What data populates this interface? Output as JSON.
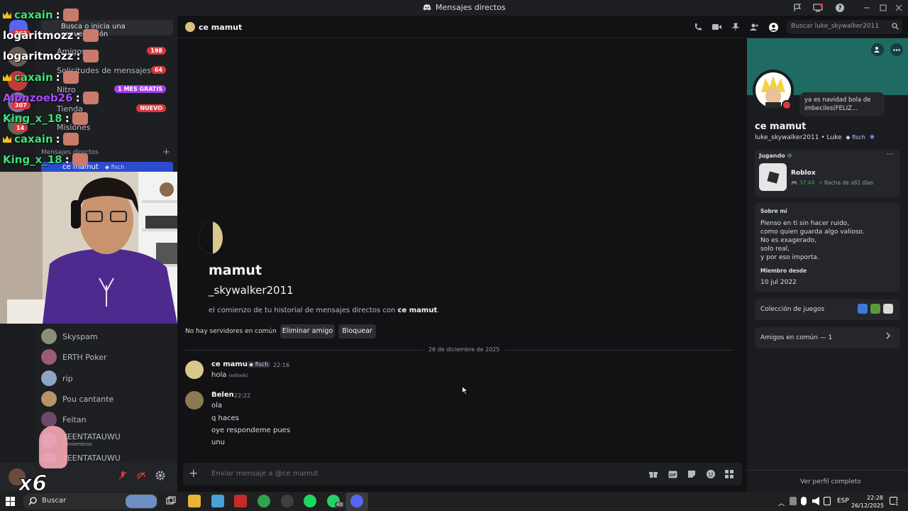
{
  "window": {
    "title": "Mensajes directos"
  },
  "sidebar": {
    "search_placeholder": "Busca o inicia una conversación",
    "nav": [
      {
        "label": "Amigos",
        "badge": "198"
      },
      {
        "label": "Solicitudes de mensajes",
        "badge": "64"
      },
      {
        "label": "Nitro",
        "badge": "1 MES GRATIS"
      },
      {
        "label": "Tienda",
        "badge": "NUEVO"
      },
      {
        "label": "Misiones",
        "badge": ""
      }
    ],
    "dm_header": "Mensajes directos",
    "dm_add": "+",
    "active_dm": {
      "name": "ce mamut",
      "tag": "fisch"
    },
    "dms": [
      {
        "name": "Skyspam",
        "sub": ""
      },
      {
        "name": "ERTH Poker",
        "sub": ""
      },
      {
        "name": "rip",
        "sub": ""
      },
      {
        "name": "Pou cantante",
        "sub": ""
      },
      {
        "name": "Feitan",
        "sub": ""
      },
      {
        "name": "YEENTATAUWU",
        "sub": "2 miembros"
      },
      {
        "name": "YEENTATAUWU",
        "sub": ""
      }
    ],
    "server_badges": [
      "263",
      "307",
      "14"
    ]
  },
  "stream_overlay": {
    "chat": [
      {
        "user": "caxain",
        "sep": ":",
        "color": "#3ee07a",
        "crown": true
      },
      {
        "user": "logaritmozz",
        "sep": ":",
        "color": "#ffffff",
        "crown": false
      },
      {
        "user": "logaritmozz",
        "sep": ":",
        "color": "#ffffff",
        "crown": false
      },
      {
        "user": "caxain",
        "sep": ":",
        "color": "#3ee07a",
        "crown": true
      },
      {
        "user": "Alonzoeb26",
        "sep": ":",
        "color": "#a64dff",
        "crown": false
      },
      {
        "user": "King_x_18",
        "sep": ":",
        "color": "#3ee07a",
        "crown": false
      },
      {
        "user": "caxain",
        "sep": ":",
        "color": "#3ee07a",
        "crown": true
      },
      {
        "user": "King_x_18",
        "sep": ":",
        "color": "#3ee07a",
        "crown": false
      }
    ],
    "multiplier": "x6"
  },
  "header": {
    "name": "ce mamut",
    "search_placeholder": "Buscar luke_skywalker2011"
  },
  "intro": {
    "name": "mamut",
    "username": "_skywalker2011",
    "text_prefix": "el comienzo de tu historial de mensajes directos con ",
    "text_name": "ce mamut",
    "text_suffix": ".",
    "no_servers": "No hay servidores en común",
    "dot": "•",
    "remove_friend": "Eliminar amigo",
    "block": "Bloquear"
  },
  "date_divider": "26 de diciembre de 2025",
  "messages": [
    {
      "author": "ce mamut",
      "tag": "fisch",
      "time": "22:16",
      "lines": [
        "hola"
      ],
      "edited": "(editado)"
    },
    {
      "author": "Belen",
      "tag": "",
      "time": "22:22",
      "lines": [
        "ola",
        "q haces",
        "oye respondeme pues",
        "unu"
      ],
      "edited": ""
    }
  ],
  "composer": {
    "placeholder": "Enviar mensaje a @ce mamut"
  },
  "profile": {
    "status": "ya es navidad bola de imbeciles(FELIZ...",
    "display_name": "ce mamut",
    "username": "luke_skywalker2011",
    "dot": "•",
    "pronoun": "Luke",
    "tag": "fisch",
    "playing_label": "Jugando",
    "game_name": "Roblox",
    "game_time": "37:44",
    "streak": "Racha de x61 días",
    "about_label": "Sobre mí",
    "about_lines": [
      "Pienso en ti sin hacer ruido,",
      "como quien guarda algo valioso.",
      "No es exagerado,",
      "solo real,",
      "y por eso importa."
    ],
    "member_since_label": "Miembro desde",
    "member_since": "10 jul 2022",
    "games_label": "Colección de juegos",
    "friends_label": "Amigos en común — 1",
    "view_full": "Ver perfil completo"
  },
  "taskbar": {
    "search": "Buscar",
    "whatsapp_badge": "40",
    "lang": "ESP",
    "time": "22:28",
    "date": "26/12/2025",
    "notif": "1"
  },
  "colors": {
    "accent": "#5865f2",
    "badge_red": "#da373c",
    "nitro": "#a83cf0",
    "online": "#23a55a"
  }
}
